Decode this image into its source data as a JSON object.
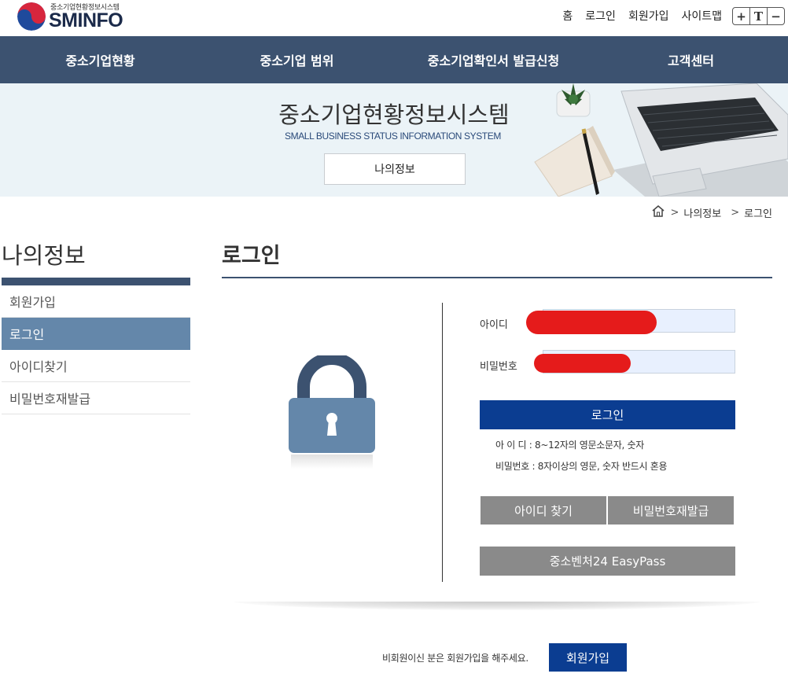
{
  "header": {
    "logo_small": "중소기업현황정보시스템",
    "logo_big": "SMINFO",
    "util_links": [
      "홈",
      "로그인",
      "회원가입",
      "사이트맵"
    ],
    "font_controls": [
      "+",
      "T",
      "−"
    ]
  },
  "gnb": {
    "items": [
      "중소기업현황",
      "중소기업 범위",
      "중소기업확인서 발급신청",
      "고객센터"
    ]
  },
  "banner": {
    "title": "중소기업현황정보시스템",
    "subtitle": "SMALL BUSINESS STATUS INFORMATION SYSTEM",
    "button_label": "나의정보"
  },
  "breadcrumb": {
    "home_icon": "home-icon",
    "items": [
      "나의정보",
      "로그인"
    ]
  },
  "sidebar": {
    "title": "나의정보",
    "items": [
      {
        "label": "회원가입",
        "active": false
      },
      {
        "label": "로그인",
        "active": true
      },
      {
        "label": "아이디찾기",
        "active": false
      },
      {
        "label": "비밀번호재발급",
        "active": false
      }
    ]
  },
  "main": {
    "title": "로그인",
    "lock_icon": "lock-icon",
    "id_label": "아이디",
    "pw_label": "비밀번호",
    "login_button": "로그인",
    "hint_id": "아 이 디 : 8~12자의 영문소문자, 숫자",
    "hint_pw": "비밀번호 : 8자이상의 영문, 숫자 반드시 혼용",
    "find_id_button": "아이디 찾기",
    "reset_pw_button": "비밀번호재발급",
    "easypass_button": "중소벤처24 EasyPass"
  },
  "footer": {
    "text": "비회원이신 분은 회원가입을 해주세요.",
    "signup_button": "회원가입"
  },
  "colors": {
    "nav_bg": "#3c5270",
    "active_item": "#6487aa",
    "primary_button": "#0b3d91",
    "gray_button": "#8a8a8a",
    "banner_bg": "#ebf3f7",
    "redaction": "#e51b1b"
  }
}
